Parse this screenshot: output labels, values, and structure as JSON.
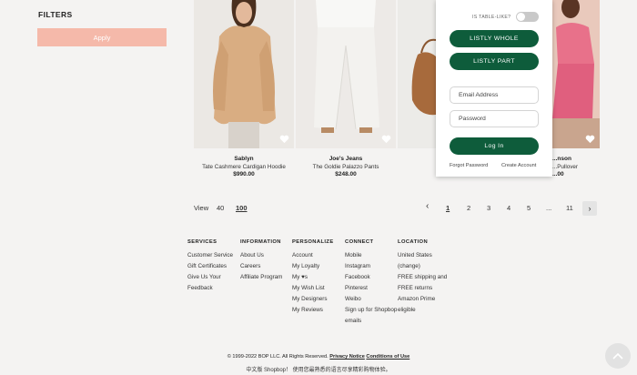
{
  "filters": {
    "title": "FILTERS",
    "apply_label": "Apply"
  },
  "products": [
    {
      "brand": "Sablyn",
      "name": "Tate Cashmere Cardigan Hoodie",
      "price": "$990.00"
    },
    {
      "brand": "Joe's Jeans",
      "name": "The Goldie Palazzo Pants",
      "price": "$248.00"
    },
    {
      "brand": "",
      "name": "",
      "price": ""
    },
    {
      "brand": "...nson",
      "name": "...Pullover",
      "price": "...00"
    }
  ],
  "popup": {
    "table_toggle_label": "IS TABLE-LIKE?",
    "btn_whole": "LISTLY  WHOLE",
    "btn_part": "LISTLY  PART",
    "email_placeholder": "Email Address",
    "password_placeholder": "Password",
    "login_label": "Log In",
    "forgot_password": "Forgot Password",
    "create_account": "Create Account"
  },
  "view": {
    "label": "View",
    "option_40": "40",
    "option_100": "100",
    "selected": "100"
  },
  "pagination": {
    "prev": "‹",
    "pages": [
      "1",
      "2",
      "3",
      "4",
      "5"
    ],
    "ellipsis": "...",
    "last": "11",
    "current": "1",
    "next": "›"
  },
  "footer": {
    "services": {
      "heading": "SERVICES",
      "items": [
        "Customer Service",
        "Gift Certificates",
        "Give Us Your",
        "Feedback"
      ]
    },
    "information": {
      "heading": "INFORMATION",
      "items": [
        "About Us",
        "Careers",
        "Affiliate Program"
      ]
    },
    "personalize": {
      "heading": "PERSONALIZE",
      "items": [
        "Account",
        "My Loyalty",
        "My ♥s",
        "My Wish List",
        "My Designers",
        "My Reviews"
      ]
    },
    "connect": {
      "heading": "CONNECT",
      "items": [
        "Mobile",
        "Instagram",
        "Facebook",
        "Pinterest",
        "Weibo",
        "Sign up for Shopbop",
        "emails"
      ]
    },
    "location": {
      "heading": "LOCATION",
      "items": [
        "United States",
        "(change)",
        "FREE shipping and",
        "FREE returns",
        "Amazon Prime",
        "eligible"
      ]
    }
  },
  "copyright": {
    "text": "© 1999-2022 BOP LLC. All Rights Reserved.",
    "privacy": "Privacy Notice",
    "conditions": "Conditions of Use"
  },
  "chinese_text": "中文版 Shopbop！ 使用您最熟悉的语言尽享精彩购物体验。",
  "colors": {
    "accent_green": "#0e5c3b",
    "apply_pink": "#f5b9aa"
  }
}
